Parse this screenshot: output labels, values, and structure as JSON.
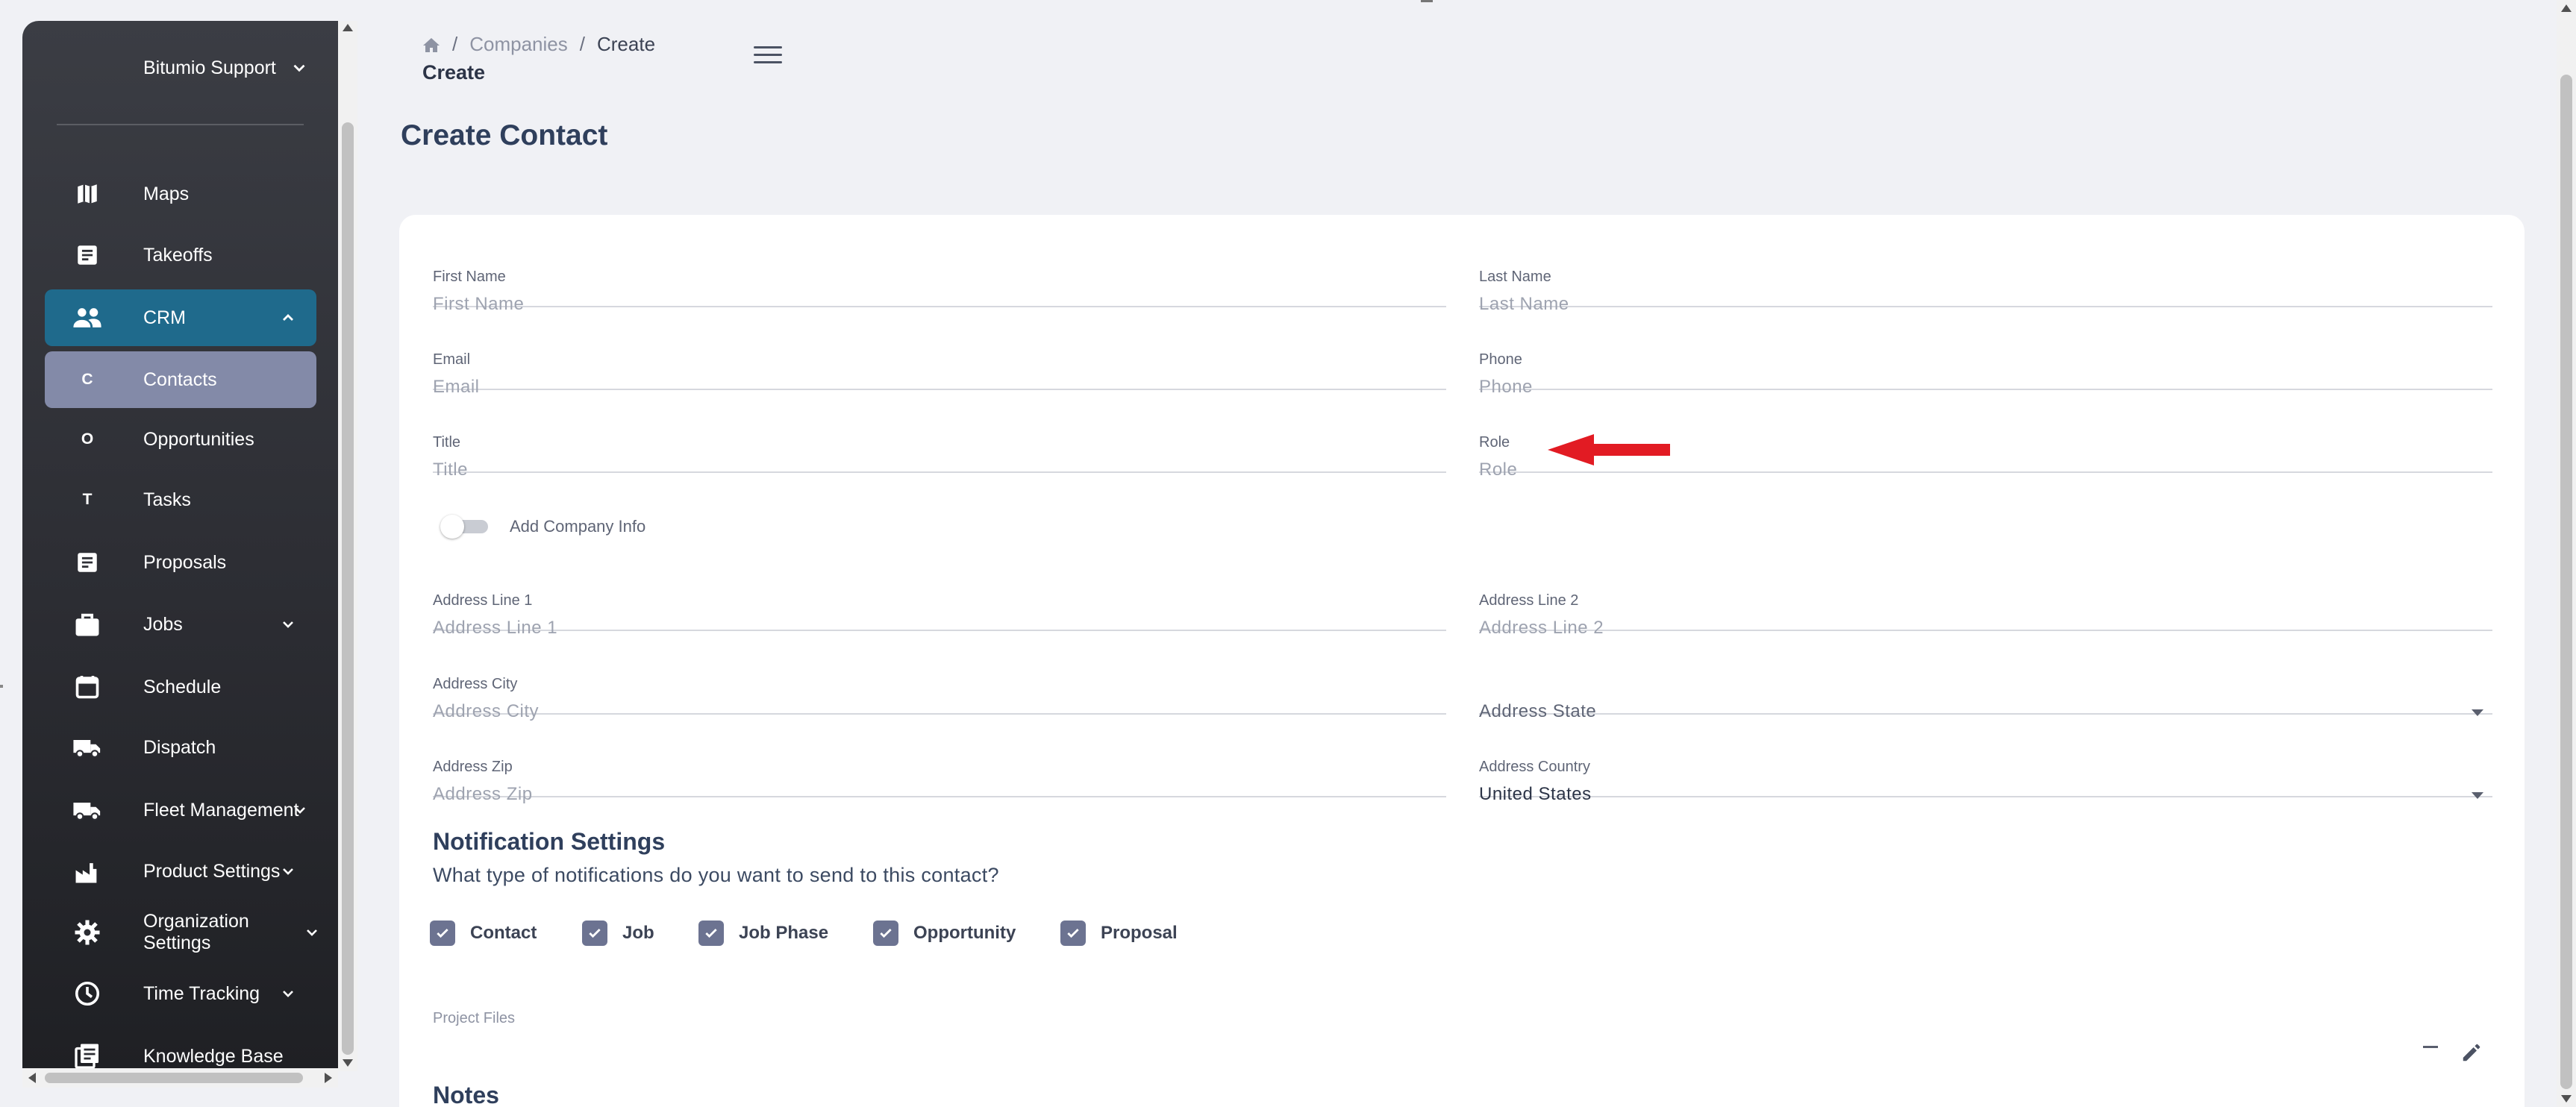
{
  "sidebar": {
    "user_menu": "Bitumio Support",
    "items": [
      {
        "label": "Maps"
      },
      {
        "label": "Takeoffs"
      },
      {
        "label": "CRM"
      },
      {
        "label": "Contacts",
        "letter": "C"
      },
      {
        "label": "Opportunities",
        "letter": "O"
      },
      {
        "label": "Tasks",
        "letter": "T"
      },
      {
        "label": "Proposals"
      },
      {
        "label": "Jobs"
      },
      {
        "label": "Schedule"
      },
      {
        "label": "Dispatch"
      },
      {
        "label": "Fleet Management"
      },
      {
        "label": "Product Settings"
      },
      {
        "label": "Organization Settings"
      },
      {
        "label": "Time Tracking"
      },
      {
        "label": "Knowledge Base"
      }
    ]
  },
  "header": {
    "breadcrumb": [
      "Companies",
      "Create"
    ],
    "crumb_title": "Create",
    "page_title": "Create Contact"
  },
  "form": {
    "first_name": {
      "label": "First Name",
      "placeholder": "First Name"
    },
    "last_name": {
      "label": "Last Name",
      "placeholder": "Last Name"
    },
    "email": {
      "label": "Email",
      "placeholder": "Email"
    },
    "phone": {
      "label": "Phone",
      "placeholder": "Phone"
    },
    "title": {
      "label": "Title",
      "placeholder": "Title"
    },
    "role": {
      "label": "Role",
      "placeholder": "Role"
    },
    "company_toggle": {
      "label": "Add Company Info",
      "on": false
    },
    "address1": {
      "label": "Address Line 1",
      "placeholder": "Address Line 1"
    },
    "address2": {
      "label": "Address Line 2",
      "placeholder": "Address Line 2"
    },
    "city": {
      "label": "Address City",
      "placeholder": "Address City"
    },
    "state": {
      "placeholder": "Address State"
    },
    "zip": {
      "label": "Address Zip",
      "placeholder": "Address Zip"
    },
    "country": {
      "label": "Address Country",
      "value": "United States"
    }
  },
  "notifications": {
    "title": "Notification Settings",
    "description": "What type of notifications do you want to send to this contact?",
    "options": [
      {
        "label": "Contact",
        "checked": true
      },
      {
        "label": "Job",
        "checked": true
      },
      {
        "label": "Job Phase",
        "checked": true
      },
      {
        "label": "Opportunity",
        "checked": true
      },
      {
        "label": "Proposal",
        "checked": true
      }
    ]
  },
  "project_files": {
    "label": "Project Files"
  },
  "notes": {
    "title": "Notes"
  },
  "colors": {
    "sidebar_active": "#1f6a8c",
    "sidebar_sub_active": "#838aa8",
    "checkbox": "#6c7391",
    "annotation_arrow": "#e21b23",
    "heading": "#2f3f5c"
  }
}
